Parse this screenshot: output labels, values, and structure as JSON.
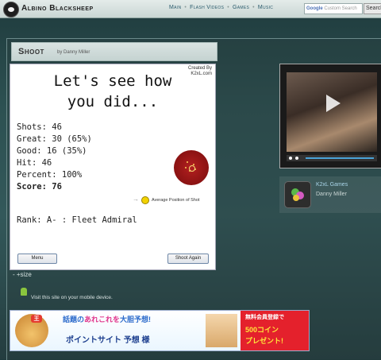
{
  "site": {
    "title": "Albino Blacksheep"
  },
  "nav": {
    "items": [
      "Main",
      "Flash Videos",
      "Games",
      "Music"
    ]
  },
  "search": {
    "placeholder": "Custom Search",
    "google": "Google",
    "button": "Search"
  },
  "page": {
    "title": "Shoot",
    "author": "by Danny Miller"
  },
  "game": {
    "created_by": "Created By",
    "created_site": "K2xL.com",
    "headline_1": "Let's see how",
    "headline_2": "you did...",
    "stats": {
      "shots": "Shots: 46",
      "great": "Great: 30 (65%)",
      "good": "Good: 16 (35%)",
      "hit": "Hit: 46",
      "percent": "Percent: 100%",
      "score": "Score: 76"
    },
    "avg_label": "Average Position of Shot",
    "rank": "Rank: A- : Fleet Admiral",
    "menu_button": "Menu",
    "again_button": "Shoot Again"
  },
  "resize_label": "- +size",
  "mobile_text": "Visit this site on your mobile device.",
  "banner": {
    "line1_a": "話題の",
    "line1_b": "あれこれを",
    "line1_c": "大胆予想!",
    "line2": "ポイントサイト 予想 様",
    "crown": "王",
    "red_1": "無料会員登録で",
    "red_2": "500コイン",
    "red_3": "プレゼント!"
  },
  "sidebar": {
    "channel_name": "K2xL Games",
    "channel_author": "Danny Miller"
  }
}
